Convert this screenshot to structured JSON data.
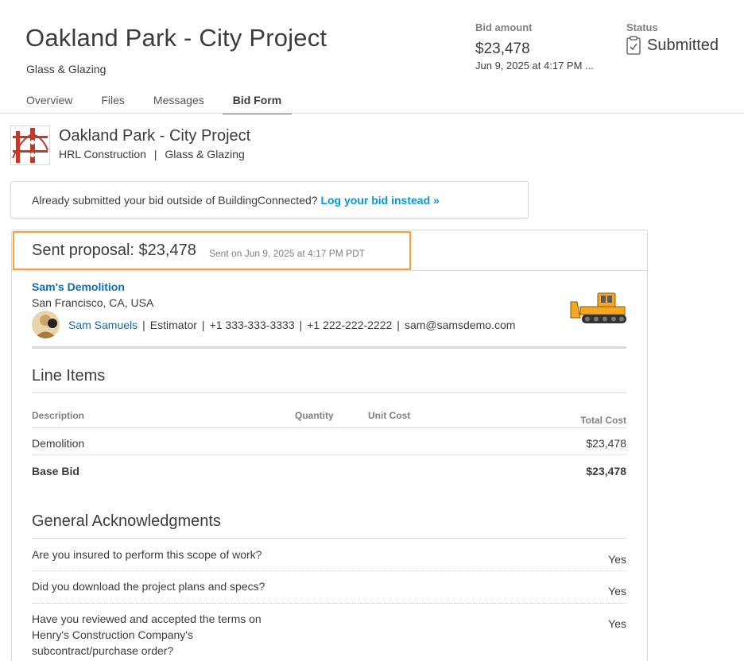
{
  "header": {
    "title": "Oakland Park - City Project",
    "trade": "Glass & Glazing",
    "bid_amount_label": "Bid amount",
    "bid_amount": "$23,478",
    "bid_date": "Jun 9, 2025 at 4:17 PM ...",
    "status_label": "Status",
    "status_value": "Submitted"
  },
  "tabs": [
    {
      "label": "Overview",
      "active": false
    },
    {
      "label": "Files",
      "active": false
    },
    {
      "label": "Messages",
      "active": false
    },
    {
      "label": "Bid Form",
      "active": true
    }
  ],
  "project_info": {
    "title": "Oakland Park - City Project",
    "company": "HRL Construction",
    "separator": "|",
    "trade": "Glass & Glazing"
  },
  "notice": {
    "text": "Already submitted your bid outside of BuildingConnected?",
    "link": "Log your bid instead »"
  },
  "proposal": {
    "title": "Sent proposal: $23,478",
    "sent": "Sent on Jun 9, 2025 at 4:17 PM PDT",
    "company": "Sam's Demolition",
    "location": "San Francisco, CA, USA",
    "contact": {
      "name": "Sam Samuels",
      "role": "Estimator",
      "phone1": "+1 333-333-3333",
      "phone2": "+1 222-222-2222",
      "email": "sam@samsdemo.com",
      "separator": "|"
    }
  },
  "line_items": {
    "title": "Line Items",
    "columns": {
      "description": "Description",
      "quantity": "Quantity",
      "unit_cost": "Unit Cost",
      "total_cost": "Total Cost"
    },
    "rows": [
      {
        "description": "Demolition",
        "total": "$23,478"
      },
      {
        "description": "Base Bid",
        "total": "$23,478"
      }
    ]
  },
  "acknowledgments": {
    "title": "General Acknowledgments",
    "items": [
      {
        "question": "Are you insured to perform this scope of work?",
        "answer": "Yes"
      },
      {
        "question": "Did you download the project plans and specs?",
        "answer": "Yes"
      },
      {
        "question": "Have you reviewed and accepted the terms on Henry's Construction Company's subcontract/purchase order?",
        "answer": "Yes"
      }
    ]
  },
  "colors": {
    "accent": "#0696d7",
    "link": "#0a6fb4",
    "highlight": "#f7a234",
    "logo_red": "#c0392b",
    "dozer_yellow": "#f5a623"
  },
  "icons": {
    "status": "clipboard-check-icon",
    "logo": "bridge-logo",
    "avatar": "user-avatar",
    "company_logo": "bulldozer-icon"
  }
}
